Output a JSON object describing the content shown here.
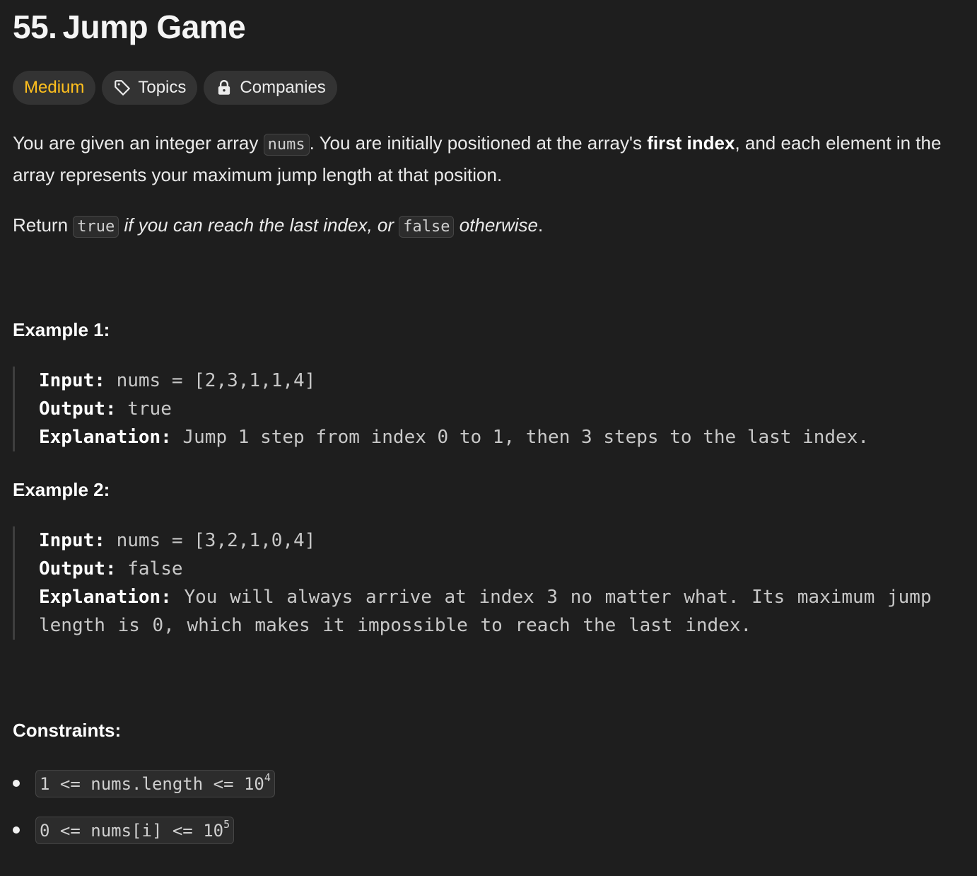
{
  "problem": {
    "number": "55.",
    "title": "Jump Game"
  },
  "tags": {
    "difficulty": "Medium",
    "topics_label": "Topics",
    "companies_label": "Companies",
    "difficulty_color": "#ffc01e"
  },
  "description": {
    "p1_a": "You are given an integer array ",
    "p1_code": "nums",
    "p1_b": ". You are initially positioned at the array's ",
    "p1_bold": "first index",
    "p1_c": ", and each element in the array represents your maximum jump length at that position.",
    "p2_a": "Return ",
    "p2_code1": "true",
    "p2_italic1": " if you can reach the last index, or ",
    "p2_code2": "false",
    "p2_italic2": " otherwise",
    "p2_end": "."
  },
  "examples": [
    {
      "heading": "Example 1:",
      "input_label": "Input:",
      "input_value": " nums = [2,3,1,1,4]",
      "output_label": "Output:",
      "output_value": " true",
      "explanation_label": "Explanation:",
      "explanation_value": " Jump 1 step from index 0 to 1, then 3 steps to the last index."
    },
    {
      "heading": "Example 2:",
      "input_label": "Input:",
      "input_value": " nums = [3,2,1,0,4]",
      "output_label": "Output:",
      "output_value": " false",
      "explanation_label": "Explanation:",
      "explanation_value": " You will always arrive at index 3 no matter what. Its maximum jump length is 0, which makes it impossible to reach the last index."
    }
  ],
  "constraints": {
    "heading": "Constraints:",
    "items": [
      {
        "text": "1 <= nums.length <= 10",
        "exponent": "4"
      },
      {
        "text": "0 <= nums[i] <= 10",
        "exponent": "5"
      }
    ]
  },
  "icons": {
    "topics": "tag-icon",
    "companies": "lock-icon"
  }
}
